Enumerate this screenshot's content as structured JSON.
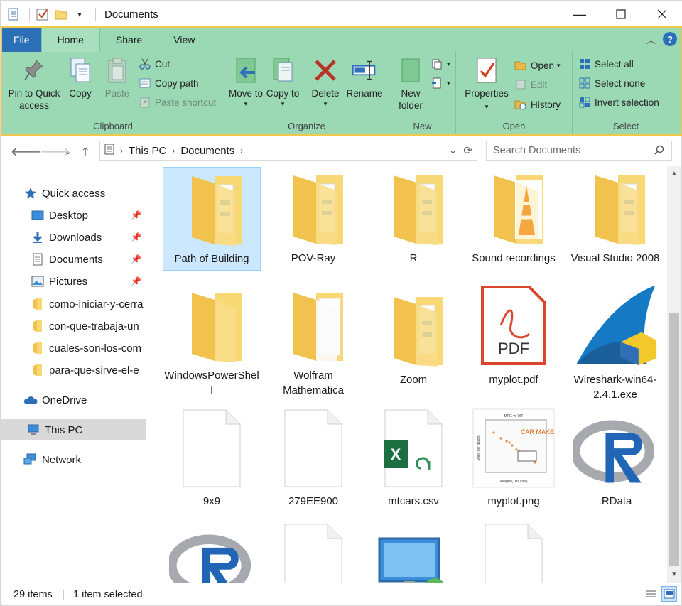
{
  "window": {
    "title": "Documents"
  },
  "ribbon": {
    "tabs": {
      "file": "File",
      "home": "Home",
      "share": "Share",
      "view": "View"
    },
    "clipboard": {
      "label": "Clipboard",
      "pin": "Pin to Quick access",
      "copy": "Copy",
      "paste": "Paste",
      "cut": "Cut",
      "copy_path": "Copy path",
      "paste_shortcut": "Paste shortcut"
    },
    "organize": {
      "label": "Organize",
      "move_to": "Move to",
      "copy_to": "Copy to",
      "delete": "Delete",
      "rename": "Rename"
    },
    "new": {
      "label": "New",
      "new_folder": "New folder"
    },
    "open": {
      "label": "Open",
      "properties": "Properties",
      "open": "Open",
      "edit": "Edit",
      "history": "History"
    },
    "select": {
      "label": "Select",
      "select_all": "Select all",
      "select_none": "Select none",
      "invert": "Invert selection"
    }
  },
  "address": {
    "crumbs": [
      "This PC",
      "Documents"
    ],
    "search_placeholder": "Search Documents"
  },
  "nav": {
    "quick_access": "Quick access",
    "items": [
      {
        "label": "Desktop",
        "pinned": true
      },
      {
        "label": "Downloads",
        "pinned": true
      },
      {
        "label": "Documents",
        "pinned": true
      },
      {
        "label": "Pictures",
        "pinned": true
      },
      {
        "label": "como-iniciar-y-cerra"
      },
      {
        "label": "con-que-trabaja-un"
      },
      {
        "label": "cuales-son-los-com"
      },
      {
        "label": "para-que-sirve-el-e"
      }
    ],
    "onedrive": "OneDrive",
    "this_pc": "This PC",
    "network": "Network"
  },
  "files": [
    {
      "name": "Path of Building",
      "kind": "folder-docs",
      "selected": true
    },
    {
      "name": "POV-Ray",
      "kind": "folder-docs"
    },
    {
      "name": "R",
      "kind": "folder-docs"
    },
    {
      "name": "Sound recordings",
      "kind": "folder-vlc"
    },
    {
      "name": "Visual Studio 2008",
      "kind": "folder-docs"
    },
    {
      "name": "WindowsPowerShell",
      "kind": "folder"
    },
    {
      "name": "Wolfram Mathematica",
      "kind": "folder-white"
    },
    {
      "name": "Zoom",
      "kind": "folder-docs"
    },
    {
      "name": "myplot.pdf",
      "kind": "pdf"
    },
    {
      "name": "Wireshark-win64-2.4.1.exe",
      "kind": "wireshark"
    },
    {
      "name": "9x9",
      "kind": "blank"
    },
    {
      "name": "279EE900",
      "kind": "blank"
    },
    {
      "name": "mtcars.csv",
      "kind": "excel"
    },
    {
      "name": "myplot.png",
      "kind": "plot"
    },
    {
      "name": ".RData",
      "kind": "rlogo"
    },
    {
      "name": "",
      "kind": "rlogo"
    },
    {
      "name": "",
      "kind": "blank"
    },
    {
      "name": "",
      "kind": "monitor"
    },
    {
      "name": "",
      "kind": "blank"
    }
  ],
  "plot_thumb": {
    "title": "MPG vs WT",
    "label": "CAR MAKE",
    "xlabel": "Weight (1000 lbs)",
    "ylabel": "Miles per gallon"
  },
  "pdf_label": "PDF",
  "excel_letter": "X",
  "status": {
    "count": "29 items",
    "selected": "1 item selected"
  },
  "colors": {
    "ribbon": "#9ad9b4",
    "ribbon_border": "#f2c84b",
    "file_tab": "#2b70b7",
    "selection": "#cce8ff",
    "folder": "#f8d775"
  }
}
